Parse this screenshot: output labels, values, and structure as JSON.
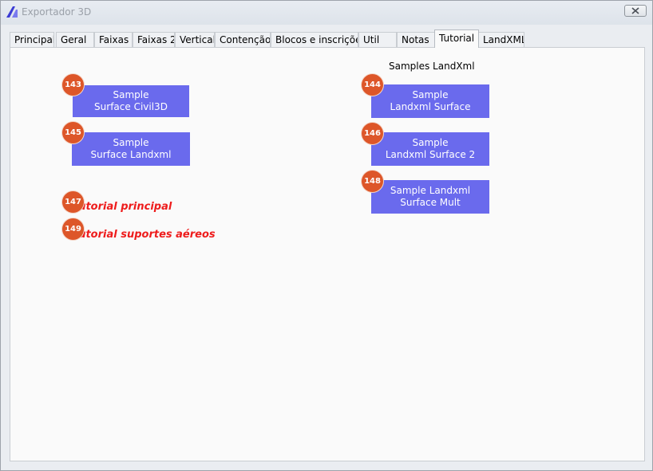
{
  "window": {
    "title": "Exportador 3D"
  },
  "tabs": [
    {
      "label": "Principal"
    },
    {
      "label": "Geral"
    },
    {
      "label": "Faixas"
    },
    {
      "label": "Faixas 2"
    },
    {
      "label": "Vertical"
    },
    {
      "label": "Contenção"
    },
    {
      "label": "Blocos e inscrições"
    },
    {
      "label": "Util"
    },
    {
      "label": "Notas"
    },
    {
      "label": "Tutorial"
    },
    {
      "label": "LandXML"
    }
  ],
  "active_tab": "Tutorial",
  "panel": {
    "samples_heading": "Samples LandXml",
    "buttons": {
      "civil3d": {
        "line1": "Sample",
        "line2": "Surface Civil3D",
        "badge": "143"
      },
      "landxml_left": {
        "line1": "Sample",
        "line2": "Surface Landxml",
        "badge": "145"
      },
      "landxml_surface": {
        "line1": "Sample",
        "line2": "Landxml Surface",
        "badge": "144"
      },
      "landxml_surface2": {
        "line1": "Sample",
        "line2": "Landxml Surface 2",
        "badge": "146"
      },
      "landxml_mult": {
        "line1": "Sample Landxml",
        "line2": "Surface Mult",
        "badge": "148"
      }
    },
    "links": {
      "tutorial_principal": {
        "label": "Tutorial principal",
        "badge": "147"
      },
      "tutorial_suportes": {
        "label": "Tutorial suportes aéreos",
        "badge": "149"
      }
    }
  },
  "colors": {
    "button_bg": "#6a6aed",
    "badge_bg": "#dd5629",
    "link_red": "#ee1c1c"
  }
}
